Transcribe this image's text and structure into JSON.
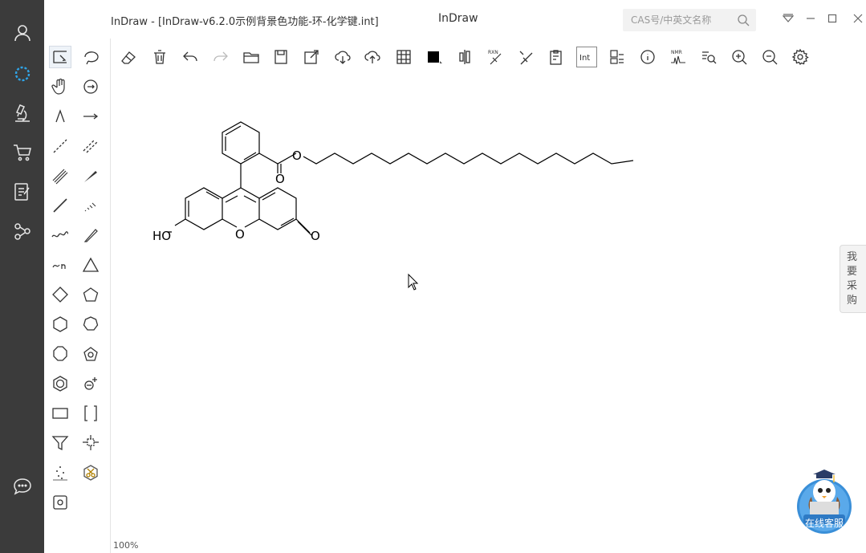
{
  "window": {
    "document_title": "InDraw - [InDraw-v6.2.0示例背景色功能-环-化学键.int]",
    "app_name": "InDraw",
    "search_placeholder": "CAS号/中英文名称"
  },
  "molecule": {
    "labels": [
      "HO",
      "O",
      "O",
      "O",
      "O"
    ]
  },
  "status": {
    "zoom": "100%"
  },
  "side_tab": {
    "label": "我要采购"
  },
  "service": {
    "label": "在线客服"
  },
  "toolbar_text": {
    "rxn": "RXN",
    "int": "Int",
    "nmr": "NMR"
  },
  "colors": {
    "nav_bg": "#3b3b3b",
    "accent": "#2fa4e7"
  }
}
